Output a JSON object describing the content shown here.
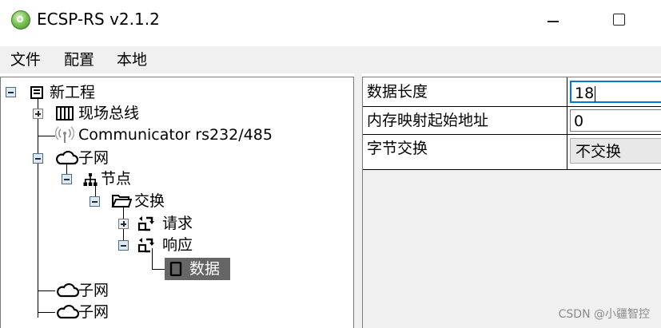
{
  "window": {
    "title": "ECSP-RS v2.1.2",
    "icon": "app-icon"
  },
  "menu": {
    "items": [
      {
        "label": "文件"
      },
      {
        "label": "配置"
      },
      {
        "label": "本地"
      }
    ]
  },
  "tree": {
    "root": {
      "label": "新工程",
      "icon": "project-icon",
      "expanded": true
    },
    "fieldbus": {
      "label": "现场总线",
      "icon": "fieldbus-icon",
      "expanded": false
    },
    "communicator": {
      "label": "Communicator rs232/485",
      "icon": "antenna-icon"
    },
    "subnet1": {
      "label": "子网",
      "icon": "cloud-icon",
      "expanded": true
    },
    "node": {
      "label": "节点",
      "icon": "network-node-icon",
      "expanded": true
    },
    "exchange": {
      "label": "交换",
      "icon": "folder-icon",
      "expanded": true
    },
    "request": {
      "label": "请求",
      "icon": "transaction-icon",
      "expanded": false
    },
    "response": {
      "label": "响应",
      "icon": "transaction-icon",
      "expanded": true
    },
    "data": {
      "label": "数据",
      "icon": "data-block-icon",
      "selected": true
    },
    "subnet2": {
      "label": "子网",
      "icon": "cloud-icon"
    },
    "subnet3": {
      "label": "子网",
      "icon": "cloud-icon"
    }
  },
  "properties": [
    {
      "name": "数据长度",
      "value": "18"
    },
    {
      "name": "内存映射起始地址",
      "value": "0"
    },
    {
      "name": "字节交换",
      "value": "不交换"
    }
  ],
  "watermark": "CSDN @小疆智控",
  "colors": {
    "selection": "#666666",
    "focus_border": "#0078d7",
    "menubar": "#f0f0f0"
  }
}
